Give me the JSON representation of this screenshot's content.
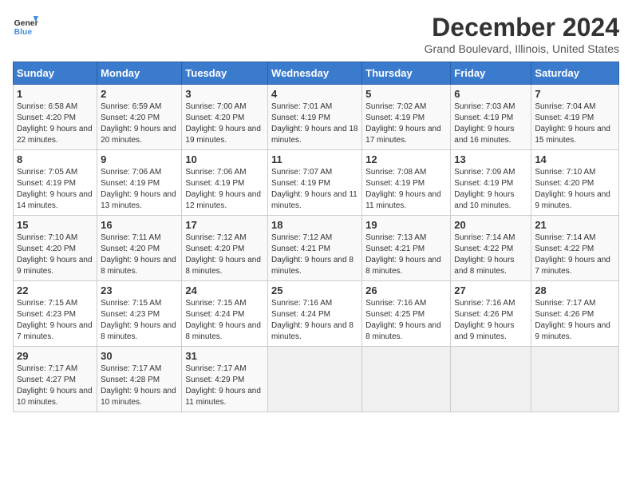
{
  "logo": {
    "line1": "General",
    "line2": "Blue"
  },
  "header": {
    "month": "December 2024",
    "location": "Grand Boulevard, Illinois, United States"
  },
  "weekdays": [
    "Sunday",
    "Monday",
    "Tuesday",
    "Wednesday",
    "Thursday",
    "Friday",
    "Saturday"
  ],
  "weeks": [
    [
      {
        "day": "1",
        "sunrise": "6:58 AM",
        "sunset": "4:20 PM",
        "daylight": "9 hours and 22 minutes."
      },
      {
        "day": "2",
        "sunrise": "6:59 AM",
        "sunset": "4:20 PM",
        "daylight": "9 hours and 20 minutes."
      },
      {
        "day": "3",
        "sunrise": "7:00 AM",
        "sunset": "4:20 PM",
        "daylight": "9 hours and 19 minutes."
      },
      {
        "day": "4",
        "sunrise": "7:01 AM",
        "sunset": "4:19 PM",
        "daylight": "9 hours and 18 minutes."
      },
      {
        "day": "5",
        "sunrise": "7:02 AM",
        "sunset": "4:19 PM",
        "daylight": "9 hours and 17 minutes."
      },
      {
        "day": "6",
        "sunrise": "7:03 AM",
        "sunset": "4:19 PM",
        "daylight": "9 hours and 16 minutes."
      },
      {
        "day": "7",
        "sunrise": "7:04 AM",
        "sunset": "4:19 PM",
        "daylight": "9 hours and 15 minutes."
      }
    ],
    [
      {
        "day": "8",
        "sunrise": "7:05 AM",
        "sunset": "4:19 PM",
        "daylight": "9 hours and 14 minutes."
      },
      {
        "day": "9",
        "sunrise": "7:06 AM",
        "sunset": "4:19 PM",
        "daylight": "9 hours and 13 minutes."
      },
      {
        "day": "10",
        "sunrise": "7:06 AM",
        "sunset": "4:19 PM",
        "daylight": "9 hours and 12 minutes."
      },
      {
        "day": "11",
        "sunrise": "7:07 AM",
        "sunset": "4:19 PM",
        "daylight": "9 hours and 11 minutes."
      },
      {
        "day": "12",
        "sunrise": "7:08 AM",
        "sunset": "4:19 PM",
        "daylight": "9 hours and 11 minutes."
      },
      {
        "day": "13",
        "sunrise": "7:09 AM",
        "sunset": "4:19 PM",
        "daylight": "9 hours and 10 minutes."
      },
      {
        "day": "14",
        "sunrise": "7:10 AM",
        "sunset": "4:20 PM",
        "daylight": "9 hours and 9 minutes."
      }
    ],
    [
      {
        "day": "15",
        "sunrise": "7:10 AM",
        "sunset": "4:20 PM",
        "daylight": "9 hours and 9 minutes."
      },
      {
        "day": "16",
        "sunrise": "7:11 AM",
        "sunset": "4:20 PM",
        "daylight": "9 hours and 8 minutes."
      },
      {
        "day": "17",
        "sunrise": "7:12 AM",
        "sunset": "4:20 PM",
        "daylight": "9 hours and 8 minutes."
      },
      {
        "day": "18",
        "sunrise": "7:12 AM",
        "sunset": "4:21 PM",
        "daylight": "9 hours and 8 minutes."
      },
      {
        "day": "19",
        "sunrise": "7:13 AM",
        "sunset": "4:21 PM",
        "daylight": "9 hours and 8 minutes."
      },
      {
        "day": "20",
        "sunrise": "7:14 AM",
        "sunset": "4:22 PM",
        "daylight": "9 hours and 8 minutes."
      },
      {
        "day": "21",
        "sunrise": "7:14 AM",
        "sunset": "4:22 PM",
        "daylight": "9 hours and 7 minutes."
      }
    ],
    [
      {
        "day": "22",
        "sunrise": "7:15 AM",
        "sunset": "4:23 PM",
        "daylight": "9 hours and 7 minutes."
      },
      {
        "day": "23",
        "sunrise": "7:15 AM",
        "sunset": "4:23 PM",
        "daylight": "9 hours and 8 minutes."
      },
      {
        "day": "24",
        "sunrise": "7:15 AM",
        "sunset": "4:24 PM",
        "daylight": "9 hours and 8 minutes."
      },
      {
        "day": "25",
        "sunrise": "7:16 AM",
        "sunset": "4:24 PM",
        "daylight": "9 hours and 8 minutes."
      },
      {
        "day": "26",
        "sunrise": "7:16 AM",
        "sunset": "4:25 PM",
        "daylight": "9 hours and 8 minutes."
      },
      {
        "day": "27",
        "sunrise": "7:16 AM",
        "sunset": "4:26 PM",
        "daylight": "9 hours and 9 minutes."
      },
      {
        "day": "28",
        "sunrise": "7:17 AM",
        "sunset": "4:26 PM",
        "daylight": "9 hours and 9 minutes."
      }
    ],
    [
      {
        "day": "29",
        "sunrise": "7:17 AM",
        "sunset": "4:27 PM",
        "daylight": "9 hours and 10 minutes."
      },
      {
        "day": "30",
        "sunrise": "7:17 AM",
        "sunset": "4:28 PM",
        "daylight": "9 hours and 10 minutes."
      },
      {
        "day": "31",
        "sunrise": "7:17 AM",
        "sunset": "4:29 PM",
        "daylight": "9 hours and 11 minutes."
      },
      null,
      null,
      null,
      null
    ]
  ]
}
